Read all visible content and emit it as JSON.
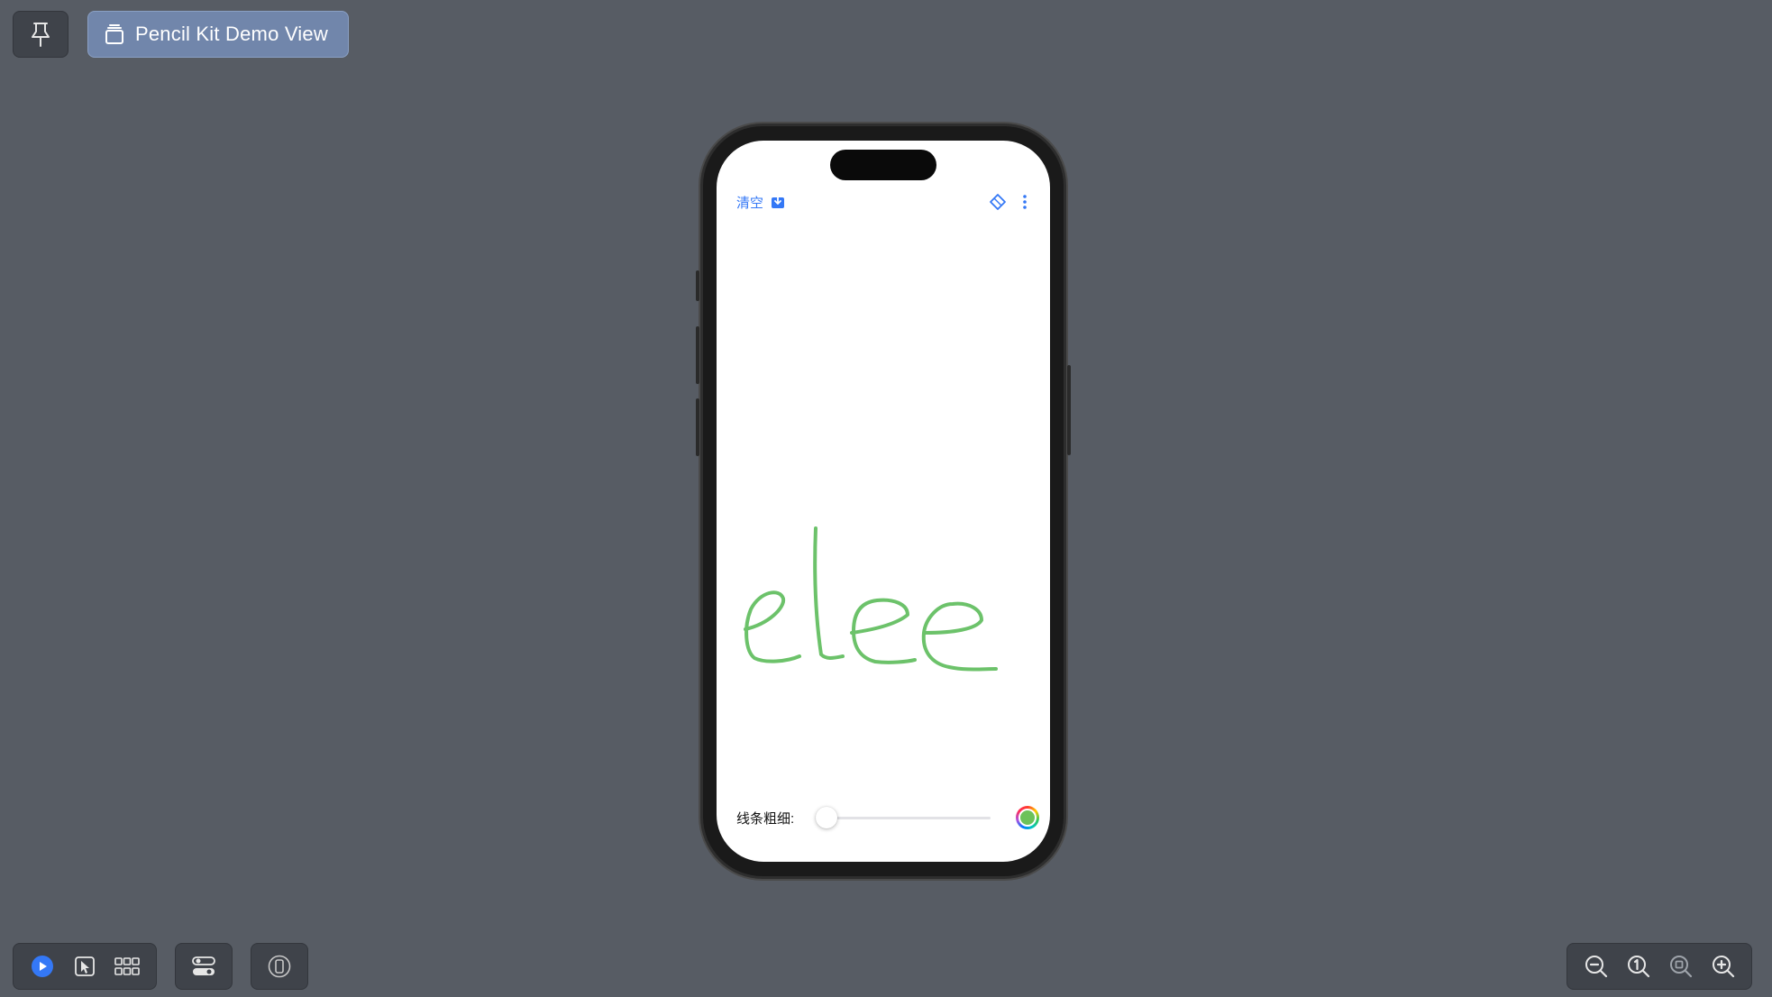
{
  "top_toolbar": {
    "pin_icon": "pin-icon",
    "preview_tab": {
      "icon": "stack-icon",
      "title": "Pencil Kit Demo View"
    }
  },
  "app": {
    "clear_label": "清空",
    "save_icon": "save-download-icon",
    "eraser_icon": "eraser-icon",
    "more_icon": "more-vertical-icon",
    "drawing_text": "elee",
    "ink_color": "#6cc26a",
    "stroke_label": "线条粗细:",
    "stroke_value": 0,
    "color_picker_icon": "color-wheel-icon"
  },
  "bottom_toolbar": {
    "live_icon": "play-icon",
    "select_icon": "selectable-cursor-icon",
    "variants_icon": "grid-icon",
    "settings_icon": "device-settings-icon",
    "device_icon": "device-icon",
    "zoom": {
      "zoom_out_icon": "zoom-out-icon",
      "actual_size_icon": "actual-size-icon",
      "zoom_fit_icon": "zoom-fit-icon",
      "zoom_in_icon": "zoom-in-icon"
    }
  },
  "colors": {
    "canvas_bg": "#575c64",
    "accent": "#3478f6",
    "tab_bg": "#7186ab"
  }
}
